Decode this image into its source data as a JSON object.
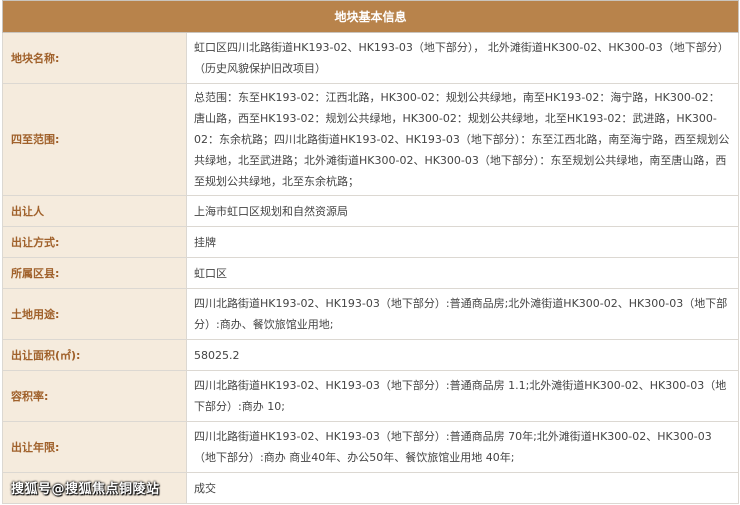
{
  "table": {
    "title": "地块基本信息",
    "rows": [
      {
        "label": "地块名称:",
        "value": "虹口区四川北路街道HK193-02、HK193-03（地下部分），  北外滩街道HK300-02、HK300-03（地下部分）（历史风貌保护旧改项目）"
      },
      {
        "label": "四至范围:",
        "value": "总范围：东至HK193-02：江西北路，HK300-02：规划公共绿地，南至HK193-02：海宁路，HK300-02：唐山路，西至HK193-02：规划公共绿地，HK300-02：规划公共绿地，北至HK193-02：武进路，HK300-02：东余杭路；四川北路街道HK193-02、HK193-03（地下部分）：东至江西北路，南至海宁路，西至规划公共绿地，北至武进路；北外滩街道HK300-02、HK300-03（地下部分）：东至规划公共绿地，南至唐山路，西至规划公共绿地，北至东余杭路；"
      },
      {
        "label": "出让人",
        "value": "上海市虹口区规划和自然资源局"
      },
      {
        "label": "出让方式:",
        "value": "挂牌"
      },
      {
        "label": "所属区县:",
        "value": "虹口区"
      },
      {
        "label": "土地用途:",
        "value": "四川北路街道HK193-02、HK193-03（地下部分）:普通商品房;北外滩街道HK300-02、HK300-03（地下部分）:商办、餐饮旅馆业用地;"
      },
      {
        "label": "出让面积(㎡):",
        "value": "58025.2"
      },
      {
        "label": "容积率:",
        "value": "四川北路街道HK193-02、HK193-03（地下部分）:普通商品房 1.1;北外滩街道HK300-02、HK300-03（地下部分）:商办 10;"
      },
      {
        "label": "出让年限:",
        "value": "四川北路街道HK193-02、HK193-03（地下部分）:普通商品房 70年;北外滩街道HK300-02、HK300-03（地下部分）:商办 商业40年、办公50年、餐饮旅馆业用地 40年;"
      },
      {
        "label": "",
        "value": "成交"
      }
    ]
  },
  "watermark": "搜狐号@搜狐焦点铜陵站"
}
